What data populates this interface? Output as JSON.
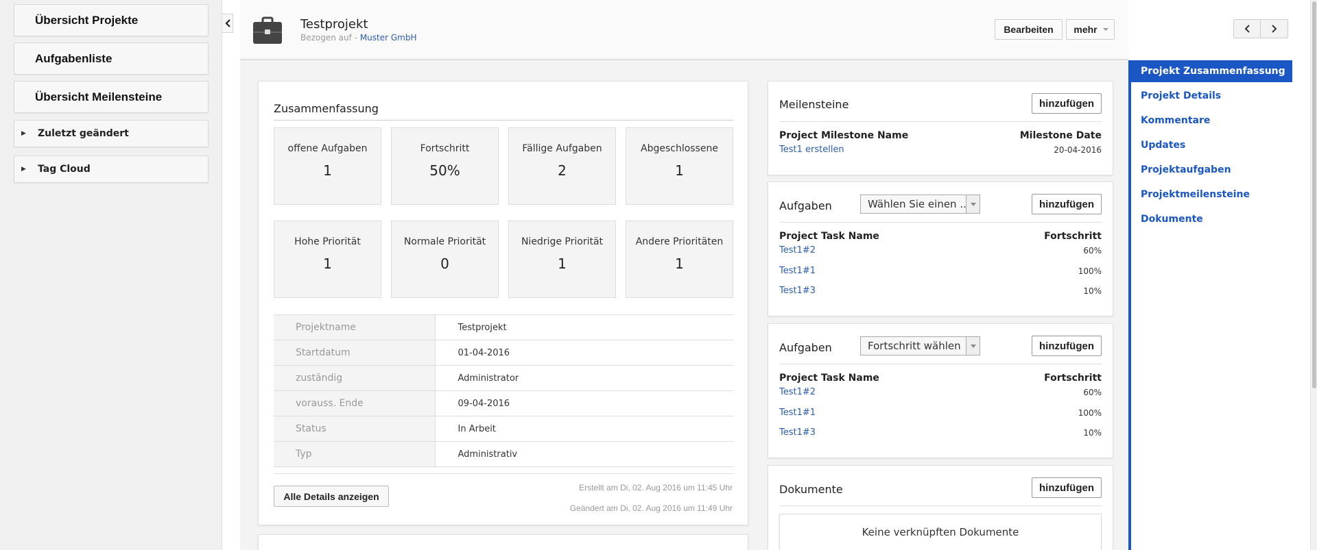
{
  "sidebar": {
    "buttons": [
      {
        "label": "Übersicht Projekte"
      },
      {
        "label": "Aufgabenliste"
      },
      {
        "label": "Übersicht Meilensteine"
      }
    ],
    "collapsibles": [
      {
        "label": "Zuletzt geändert"
      },
      {
        "label": "Tag Cloud"
      }
    ]
  },
  "header": {
    "title": "Testprojekt",
    "related_prefix": "Bezogen auf - ",
    "related_link": "Muster GmbH",
    "edit_label": "Bearbeiten",
    "more_label": "mehr"
  },
  "summary": {
    "title": "Zusammenfassung",
    "stats": [
      {
        "label": "offene Aufgaben",
        "value": "1"
      },
      {
        "label": "Fortschritt",
        "value": "50%"
      },
      {
        "label": "Fällige Aufgaben",
        "value": "2"
      },
      {
        "label": "Abgeschlossene",
        "value": "1"
      },
      {
        "label": "Hohe Priorität",
        "value": "1"
      },
      {
        "label": "Normale Priorität",
        "value": "0"
      },
      {
        "label": "Niedrige Priorität",
        "value": "1"
      },
      {
        "label": "Andere Prioritäten",
        "value": "1"
      }
    ],
    "details": [
      {
        "key": "Projektname",
        "value": "Testprojekt"
      },
      {
        "key": "Startdatum",
        "value": "01-04-2016"
      },
      {
        "key": "zuständig",
        "value": "Administrator"
      },
      {
        "key": "vorauss. Ende",
        "value": "09-04-2016"
      },
      {
        "key": "Status",
        "value": "In Arbeit"
      },
      {
        "key": "Typ",
        "value": "Administrativ"
      }
    ],
    "all_details_label": "Alle Details anzeigen",
    "created": "Erstellt am Di, 02. Aug 2016 um 11:45 Uhr",
    "modified": "Geändert am Di, 02. Aug 2016 um 11:49 Uhr"
  },
  "milestones": {
    "title": "Meilensteine",
    "add_label": "hinzufügen",
    "col_name": "Project Milestone Name",
    "col_date": "Milestone Date",
    "rows": [
      {
        "name": "Test1 erstellen",
        "date": "20-04-2016"
      }
    ]
  },
  "tasks1": {
    "title": "Aufgaben",
    "select_value": "Wählen Sie einen ...",
    "add_label": "hinzufügen",
    "col_name": "Project Task Name",
    "col_progress": "Fortschritt",
    "rows": [
      {
        "name": "Test1#2",
        "progress": "60%"
      },
      {
        "name": "Test1#1",
        "progress": "100%"
      },
      {
        "name": "Test1#3",
        "progress": "10%"
      }
    ]
  },
  "tasks2": {
    "title": "Aufgaben",
    "select_value": "Fortschritt wählen",
    "add_label": "hinzufügen",
    "col_name": "Project Task Name",
    "col_progress": "Fortschritt",
    "rows": [
      {
        "name": "Test1#2",
        "progress": "60%"
      },
      {
        "name": "Test1#1",
        "progress": "100%"
      },
      {
        "name": "Test1#3",
        "progress": "10%"
      }
    ]
  },
  "documents": {
    "title": "Dokumente",
    "add_label": "hinzufügen",
    "empty_text": "Keine verknüpften Dokumente"
  },
  "right_nav": {
    "items": [
      {
        "label": "Projekt Zusammenfassung"
      },
      {
        "label": "Projekt Details"
      },
      {
        "label": "Kommentare"
      },
      {
        "label": "Updates"
      },
      {
        "label": "Projektaufgaben"
      },
      {
        "label": "Projektmeilensteine"
      },
      {
        "label": "Dokumente"
      }
    ]
  },
  "colors": {
    "accent": "#1a56c4",
    "link": "#2a5db0"
  },
  "icons": [
    "briefcase-icon",
    "chevron-left-icon",
    "chevron-right-icon",
    "triangle-right-icon",
    "caret-down-icon"
  ]
}
